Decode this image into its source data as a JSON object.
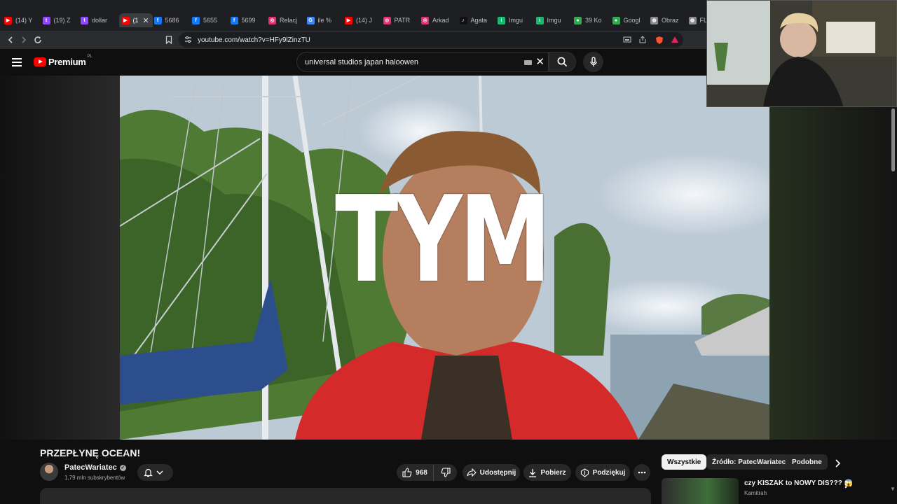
{
  "browser": {
    "tabs": [
      {
        "label": "(14) Y",
        "icon": "youtube-icon",
        "color": "#ff0000"
      },
      {
        "label": "(19) Z",
        "icon": "twitch-icon",
        "color": "#9146ff"
      },
      {
        "label": "dollar",
        "icon": "twitch-icon",
        "color": "#9146ff"
      },
      {
        "label": "(1",
        "icon": "youtube-icon",
        "color": "#ff0000",
        "active": true
      },
      {
        "label": "5686",
        "icon": "facebook-icon",
        "color": "#1877f2"
      },
      {
        "label": "5655",
        "icon": "facebook-icon",
        "color": "#1877f2"
      },
      {
        "label": "5699",
        "icon": "facebook-icon",
        "color": "#1877f2"
      },
      {
        "label": "Relacj",
        "icon": "instagram-icon",
        "color": "#e1306c"
      },
      {
        "label": "ile %",
        "icon": "google-icon",
        "color": "#4285f4"
      },
      {
        "label": "(14) J",
        "icon": "youtube-icon",
        "color": "#ff0000"
      },
      {
        "label": "PATR",
        "icon": "instagram-icon",
        "color": "#e1306c"
      },
      {
        "label": "Arkad",
        "icon": "instagram-icon",
        "color": "#e1306c"
      },
      {
        "label": "Agata",
        "icon": "tiktok-icon",
        "color": "#111111"
      },
      {
        "label": "Imgu",
        "icon": "imgur-icon",
        "color": "#1bb76e"
      },
      {
        "label": "Imgu",
        "icon": "imgur-icon",
        "color": "#1bb76e"
      },
      {
        "label": "39 Ko",
        "icon": "maps-icon",
        "color": "#34a853"
      },
      {
        "label": "Googl",
        "icon": "maps-icon",
        "color": "#34a853"
      },
      {
        "label": "Obraz",
        "icon": "globe-icon",
        "color": "#888888"
      },
      {
        "label": "FL",
        "icon": "globe-icon",
        "color": "#888888"
      }
    ],
    "url": "youtube.com/watch?v=HFy9lZinzTU"
  },
  "youtube": {
    "logo_text": "Premium",
    "country_code": "PL",
    "search_value": "universal studios japan haloowen"
  },
  "video": {
    "overlay_text": "TYM",
    "title": "PRZEPŁYNĘ OCEAN!",
    "channel": "PatecWariatec",
    "subscribers": "1,79 mln subskrybentów",
    "likes": "968",
    "share_label": "Udostępnij",
    "download_label": "Pobierz",
    "thanks_label": "Podziękuj"
  },
  "sidebar": {
    "chips": [
      "Wszystkie",
      "Źródło: PatecWariatec",
      "Podobne"
    ],
    "recommendation": {
      "title": "czy KISZAK to NOWY DIS??? 😱",
      "channel": "Kamitrah"
    }
  },
  "colors": {
    "youtube_red": "#ff0000",
    "background": "#0f0f0f",
    "pill": "#272727"
  }
}
